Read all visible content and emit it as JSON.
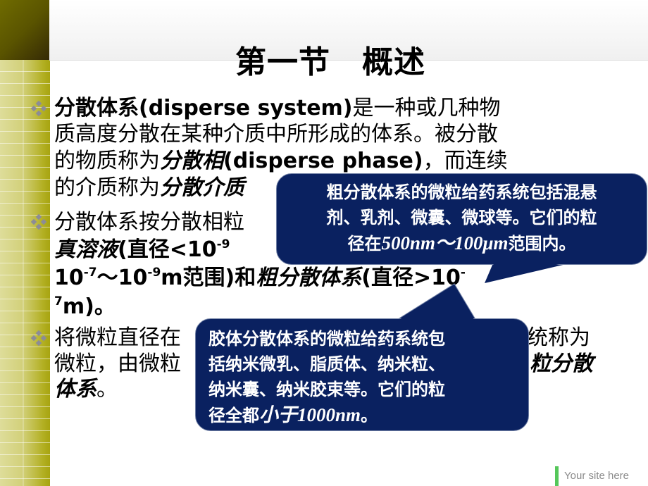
{
  "title": "第一节　概述",
  "body": {
    "l1_bold": "分散体系(disperse system)",
    "l1_rest": "是一种或几种物",
    "l2": "质高度分散在某种介质中所形成的体系。被分散",
    "l3_a": "的物质称为",
    "l3_i": "分散相",
    "l3_b": "(disperse phase)",
    "l3_c": "，而连续",
    "l4_a": "的介质称为",
    "l4_i": "分散介质",
    "l5": "分散体系按分散相粒",
    "l6_i": "真溶液",
    "l6_a": "(直径<10",
    "l6_sup": "-9",
    "l7_a": "10",
    "l7_sup1": "-7",
    "l7_b": "～10",
    "l7_sup2": "-9",
    "l7_c": "m范围)和",
    "l7_i": "粗分散体系",
    "l7_d": "(直径>10",
    "l7_sup3": "-",
    "l8_sup": "7",
    "l8_a": "m)。",
    "l9_a": "将微粒直径在",
    "l9_b": "统称为",
    "l10_a": "微粒，由微粒",
    "l10_i": "粒分散",
    "l11_i": "体系",
    "l11_a": "。"
  },
  "callout1": {
    "line1": "粗分散体系的微粒给药系统包括混悬",
    "line2": "剂、乳剂、微囊、微球等。它们的粒",
    "line3_a": "径在",
    "line3_em": "500nm～100μm",
    "line3_b": "范围内。"
  },
  "callout2": {
    "line1": "胶体分散体系的微粒给药系统包",
    "line2": "括纳米微乳、脂质体、纳米粒、",
    "line3": "纳米囊、纳米胶束等。它们的粒",
    "line4_a": "径全都",
    "line4_em": "小于1000nm",
    "line4_b": "。"
  },
  "footer": "Your site here",
  "colors": {
    "callout_bg": "#0a2160",
    "footer_accent": "#55c75a",
    "bullet": "#8c8c96"
  }
}
